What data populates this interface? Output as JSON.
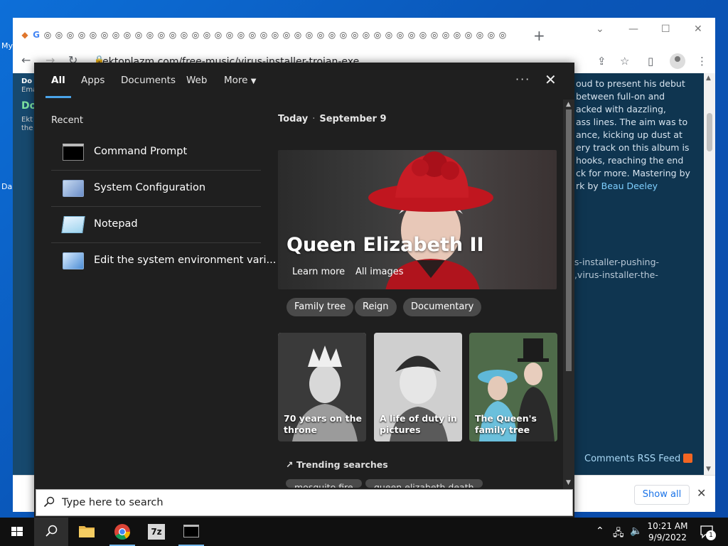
{
  "browser": {
    "url": "ektoplazm.com/free-music/virus-installer-trojan-exe",
    "new_tab_symbol": "+",
    "page_text_top": "oud to present his debut\nbetween full-on and\nacked with dazzling,\nass lines. The aim was to\nance, kicking up dust at\nery track on this album is\nhooks, reaching the end\nck for more. Mastering by\nrk by ",
    "page_text_link": "Beau Deeley",
    "page_text_bottom": "us-installer-pushing-\n3,virus-installer-the-",
    "rss_label": "Comments RSS Feed",
    "left_fragments": [
      "Do",
      "Ema",
      "Do",
      "Ekt",
      "the",
      "My",
      "Da"
    ]
  },
  "download_bar": {
    "show_all_label": "Show all",
    "close_symbol": "✕"
  },
  "search": {
    "tabs": [
      {
        "label": "All"
      },
      {
        "label": "Apps"
      },
      {
        "label": "Documents"
      },
      {
        "label": "Web"
      },
      {
        "label": "More"
      }
    ],
    "more_symbol": "···",
    "close_symbol": "✕",
    "recent_heading": "Recent",
    "recent_items": [
      {
        "label": "Command Prompt",
        "icon": "command-prompt-icon"
      },
      {
        "label": "System Configuration",
        "icon": "system-configuration-icon"
      },
      {
        "label": "Notepad",
        "icon": "notepad-icon"
      },
      {
        "label": "Edit the system environment vari...",
        "icon": "environment-variables-icon"
      }
    ],
    "today_label": "Today",
    "today_date": "September 9",
    "hero": {
      "title": "Queen Elizabeth II",
      "learn_more": "Learn more",
      "all_images": "All images"
    },
    "chips": [
      "Family tree",
      "Reign",
      "Documentary"
    ],
    "cards": [
      {
        "caption": "70 years on the throne"
      },
      {
        "caption": "A life of duty in pictures"
      },
      {
        "caption": "The Queen's family tree"
      }
    ],
    "trending_heading": "Trending searches",
    "trending_chips": [
      "mosquito fire",
      "queen elizabeth death"
    ],
    "box_placeholder": "Type here to search"
  },
  "taskbar": {
    "clock_time": "10:21 AM",
    "clock_date": "9/9/2022",
    "notification_count": "1",
    "sevenzip_label": "7z"
  },
  "colors": {
    "accent": "#4aa3e8",
    "panel_bg": "#1f1f1f",
    "chip_bg": "#4a4a4a",
    "page_bg": "#0f3550",
    "link": "#1a73e8"
  }
}
